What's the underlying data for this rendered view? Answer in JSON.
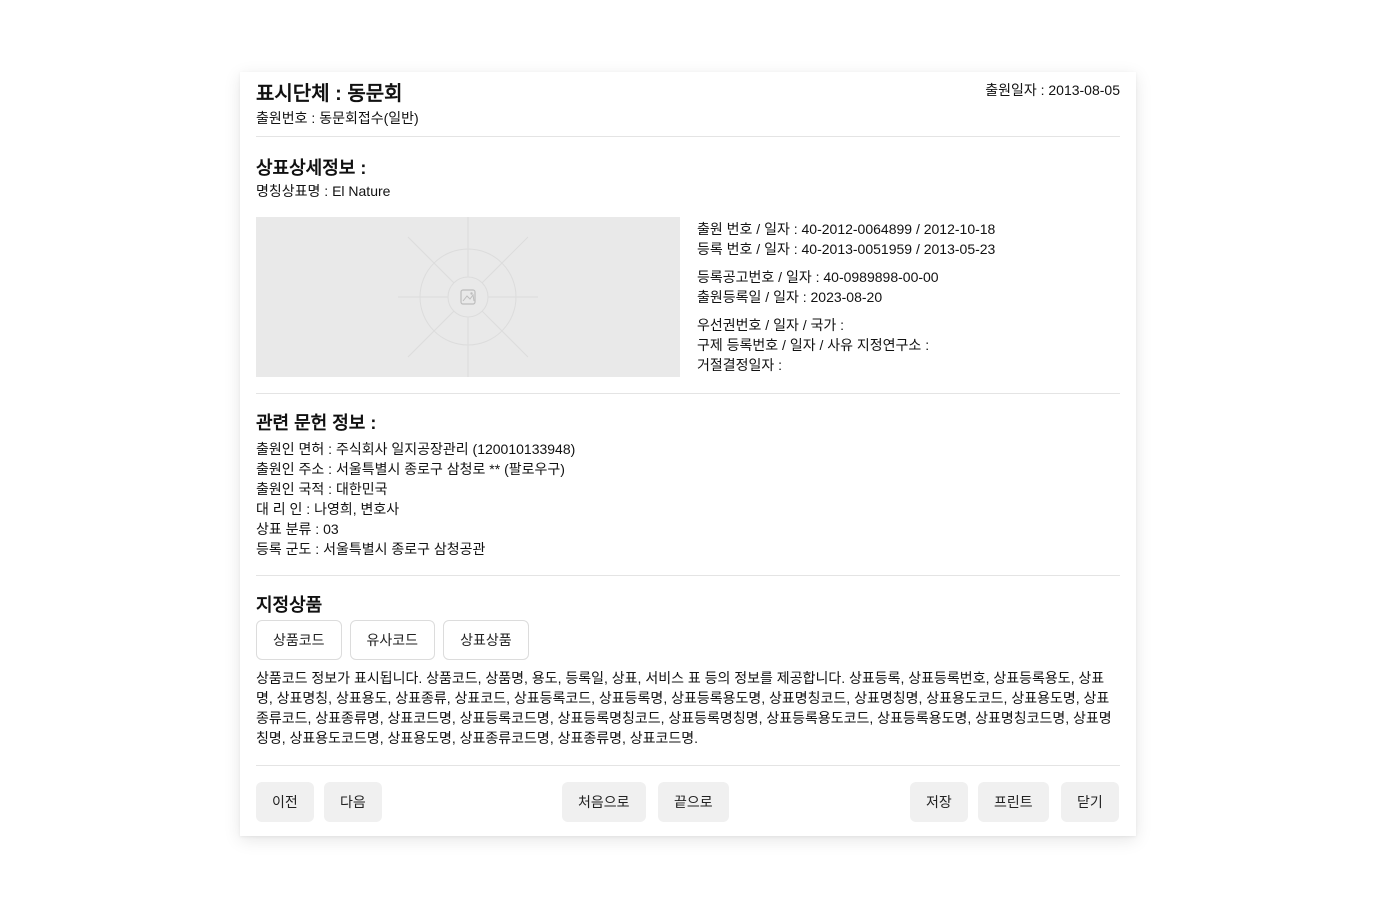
{
  "header": {
    "title": "표시단체 : 동문회",
    "application_no": "출원번호 : 동문회접수(일반)",
    "application_date": "출원일자 : 2013-08-05"
  },
  "detail": {
    "title": "상표상세정보 :",
    "mark_name": "명칭상표명 : El Nature",
    "info_groups": [
      [
        "출원 번호 / 일자 : 40-2012-0064899 / 2012-10-18",
        "등록 번호 / 일자 : 40-2013-0051959 / 2013-05-23"
      ],
      [
        "등록공고번호 / 일자 : 40-0989898-00-00",
        "출원등록일 / 일자 : 2023-08-20"
      ],
      [
        "우선권번호 / 일자 / 국가 :",
        "구제 등록번호 / 일자 / 사유 지정연구소 :",
        "거절결정일자 :"
      ]
    ]
  },
  "related": {
    "title": "관련 문헌 정보 :",
    "lines": [
      "출원인 면허 : 주식회사 일지공장관리 (120010133948)",
      "출원인 주소 : 서울특별시 종로구 삼청로 ** (팔로우구)",
      "출원인 국적 : 대한민국",
      "대 리 인 : 나영희, 변호사",
      "상표 분류 : 03",
      "등록 군도 : 서울특별시 종로구 삼청공관"
    ]
  },
  "goods": {
    "title": "지정상품",
    "tabs": [
      "상품코드",
      "유사코드",
      "상표상품"
    ],
    "description": "상품코드 정보가 표시됩니다. 상품코드, 상품명, 용도, 등록일, 상표, 서비스 표 등의 정보를 제공합니다. 상표등록, 상표등록번호, 상표등록용도, 상표명, 상표명칭, 상표용도, 상표종류, 상표코드, 상표등록코드, 상표등록명, 상표등록용도명, 상표명칭코드, 상표명칭명, 상표용도코드, 상표용도명, 상표종류코드, 상표종류명, 상표코드명, 상표등록코드명, 상표등록명칭코드, 상표등록명칭명, 상표등록용도코드, 상표등록용도명, 상표명칭코드명, 상표명칭명, 상표용도코드명, 상표용도명, 상표종류코드명, 상표종류명, 상표코드명."
  },
  "footer": {
    "prev": "이전",
    "next": "다음",
    "first": "처음으로",
    "last": "끝으로",
    "save": "저장",
    "print": "프린트",
    "close": "닫기"
  },
  "icons": {
    "image_placeholder": "image-icon"
  }
}
